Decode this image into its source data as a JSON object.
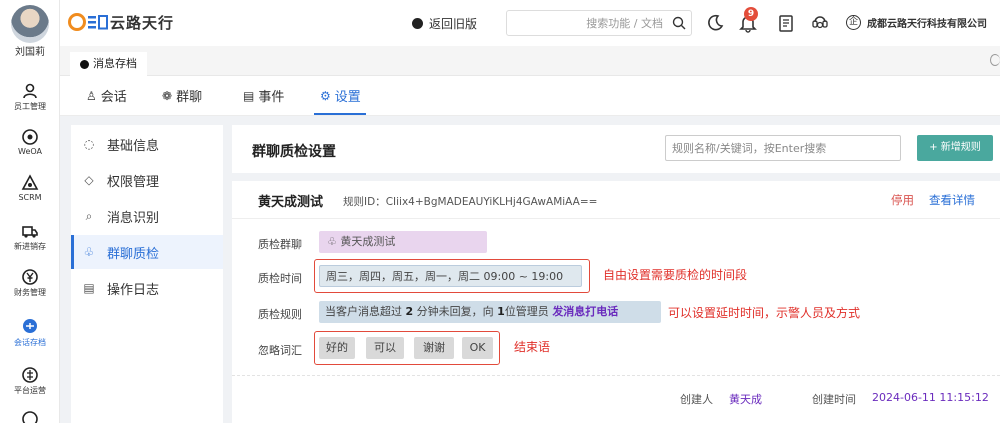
{
  "user": {
    "name": "刘国莉"
  },
  "rail": [
    {
      "icon": "person-icon",
      "label": "员工管理"
    },
    {
      "icon": "target-icon",
      "label": "WeOA"
    },
    {
      "icon": "scrm-icon",
      "label": "SCRM"
    },
    {
      "icon": "truck-icon",
      "label": "新进销存"
    },
    {
      "icon": "yen-icon",
      "label": "财务管理"
    },
    {
      "icon": "chat-archive-icon",
      "label": "会话存档",
      "active": true
    },
    {
      "icon": "platform-icon",
      "label": "平台运营"
    }
  ],
  "header": {
    "logo_text": "云路天行",
    "old_version": "返回旧版",
    "search_placeholder": "搜索功能 / 文档",
    "bell_count": "9",
    "company_badge": "企",
    "company": "成都云路天行科技有限公司"
  },
  "page_tab": {
    "label": "消息存档"
  },
  "module_tabs": [
    {
      "icon": "♙",
      "label": "会话"
    },
    {
      "icon": "❁",
      "label": "群聊"
    },
    {
      "icon": "▤",
      "label": "事件"
    },
    {
      "icon": "⚙",
      "label": "设置",
      "active": true
    }
  ],
  "sub_nav": [
    {
      "icon": "◌",
      "label": "基础信息"
    },
    {
      "icon": "◇",
      "label": "权限管理"
    },
    {
      "icon": "⌕",
      "label": "消息识别"
    },
    {
      "icon": "♧",
      "label": "群聊质检",
      "active": true
    },
    {
      "icon": "▤",
      "label": "操作日志"
    }
  ],
  "main": {
    "title": "群聊质检设置",
    "search_placeholder": "规则名称/关键词，按Enter搜索",
    "add_button": "+ 新增规则"
  },
  "rule": {
    "name": "黄天成测试",
    "id_label": "规则ID：",
    "id_value": "CIiix4+BgMADEAUYiKLHj4GAwAMiAA==",
    "disable": "停用",
    "detail": "查看详情",
    "fields": {
      "group_label": "质检群聊",
      "group_value": "黄天成测试",
      "time_label": "质检时间",
      "time_value": "周三，周四，周五，周一，周二 09:00 ~ 19:00",
      "rule_label": "质检规则",
      "rule_prefix": "当客户消息超过",
      "rule_minutes": "2",
      "rule_mid": "分钟未回复，向",
      "rule_count": "1",
      "rule_suffix": "位管理员",
      "rule_action": "发消息打电话",
      "ignore_label": "忽略词汇",
      "ignore_words": [
        "好的",
        "可以",
        "谢谢",
        "OK"
      ]
    },
    "creator_label": "创建人",
    "creator": "黄天成",
    "created_label": "创建时间",
    "created_time": "2024-06-11 11:15:12"
  },
  "annotations": {
    "time": "自由设置需要质检的时间段",
    "rule": "可以设置延时时间，示警人员及方式",
    "words": "结束语"
  },
  "colors": {
    "accent": "#2a6fd6",
    "add_button": "#4aa89e",
    "annotation": "#e0302a",
    "badge": "#e34d3a"
  }
}
